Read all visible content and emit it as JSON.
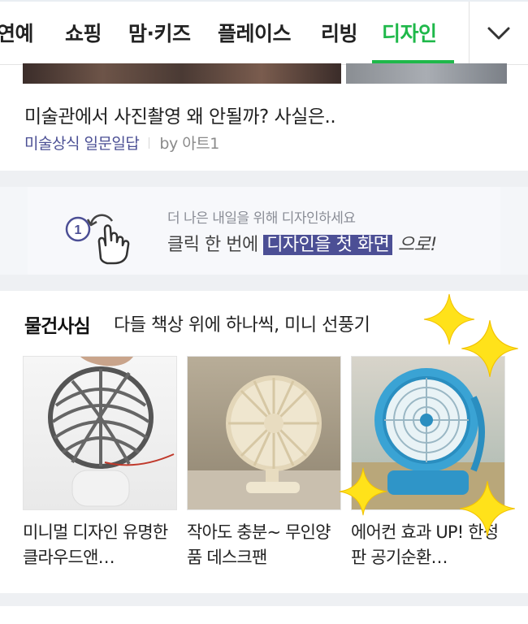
{
  "tabs": [
    {
      "label": "연예"
    },
    {
      "label": "쇼핑"
    },
    {
      "label": "맘·키즈"
    },
    {
      "label": "플레이스"
    },
    {
      "label": "리빙"
    },
    {
      "label": "디자인"
    }
  ],
  "active_tab": "디자인",
  "article": {
    "title": "미술관에서 사진촬영 왜 안될까? 사실은..",
    "category": "미술상식 일문일답",
    "author": "by 아트1"
  },
  "banner": {
    "step_number": "1",
    "subtitle": "더 나은 내일을 위해 디자인하세요",
    "main_prefix": "클릭 한 번에 ",
    "main_highlight": "디자인을 첫 화면",
    "main_suffix": " 으로!"
  },
  "products_section": {
    "title": "물건사심",
    "subtitle": "다들 책상 위에 하나씩, 미니 선풍기",
    "items": [
      {
        "name": "미니멀 디자인 유명한 클라우드앤…"
      },
      {
        "name": "작아도 충분~ 무인양품 데스크팬"
      },
      {
        "name": "에어컨 효과 UP! 한정판 공기순환…"
      }
    ]
  },
  "colors": {
    "accent_green": "#1fb84a",
    "category_purple": "#4b4f94",
    "highlight_bg": "#4c4f95",
    "sparkle_yellow": "#ffe21a"
  }
}
